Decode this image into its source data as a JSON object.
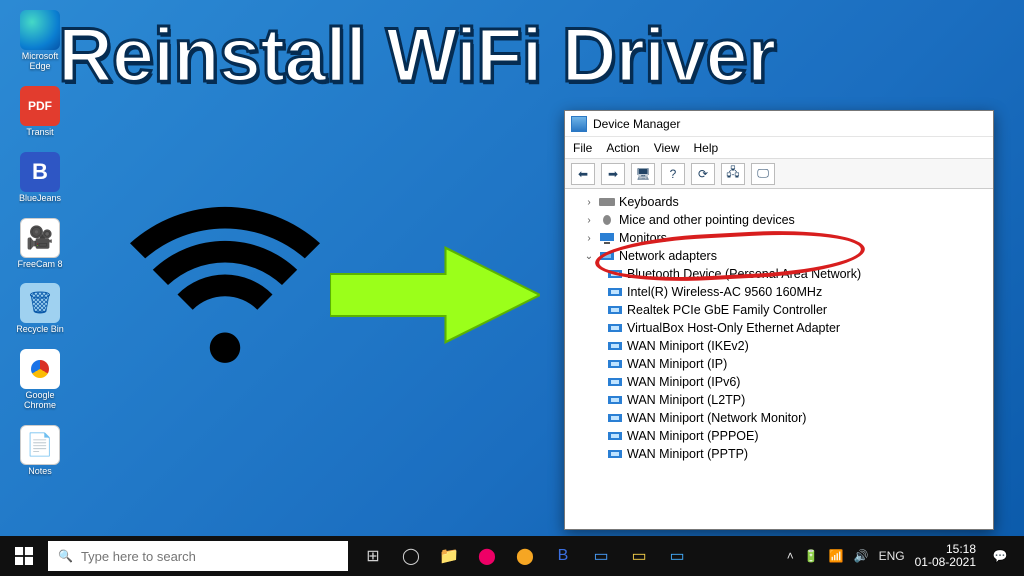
{
  "title_overlay": "Reinstall WiFi Driver",
  "desktop_icons": [
    {
      "label": "Microsoft Edge",
      "kind": "edge"
    },
    {
      "label": "Transit",
      "kind": "pdf"
    },
    {
      "label": "BlueJeans",
      "kind": "bj"
    },
    {
      "label": "FreeCam 8",
      "kind": "cam"
    },
    {
      "label": "Recycle Bin",
      "kind": "bin"
    },
    {
      "label": "Google Chrome",
      "kind": "chr"
    },
    {
      "label": "Notes",
      "kind": "notes"
    }
  ],
  "pdf_badge": "PDF",
  "bj_badge": "B",
  "device_manager": {
    "window_title": "Device Manager",
    "menu": [
      "File",
      "Action",
      "View",
      "Help"
    ],
    "categories": [
      {
        "label": "Keyboards",
        "icon": "kb",
        "twist": "›"
      },
      {
        "label": "Mice and other pointing devices",
        "icon": "mouse",
        "twist": "›"
      },
      {
        "label": "Monitors",
        "icon": "moni",
        "twist": "›"
      },
      {
        "label": "Network adapters",
        "icon": "net",
        "twist": "⌄",
        "children": [
          "Bluetooth Device (Personal Area Network)",
          "Intel(R) Wireless-AC 9560 160MHz",
          "Realtek PCIe GbE Family Controller",
          "VirtualBox Host-Only Ethernet Adapter",
          "WAN Miniport (IKEv2)",
          "WAN Miniport (IP)",
          "WAN Miniport (IPv6)",
          "WAN Miniport (L2TP)",
          "WAN Miniport (Network Monitor)",
          "WAN Miniport (PPPOE)",
          "WAN Miniport (PPTP)"
        ]
      }
    ]
  },
  "taskbar": {
    "search_placeholder": "Type here to search",
    "tray_lang": "ENG",
    "tray_time": "15:18",
    "tray_date": "01-08-2021"
  }
}
